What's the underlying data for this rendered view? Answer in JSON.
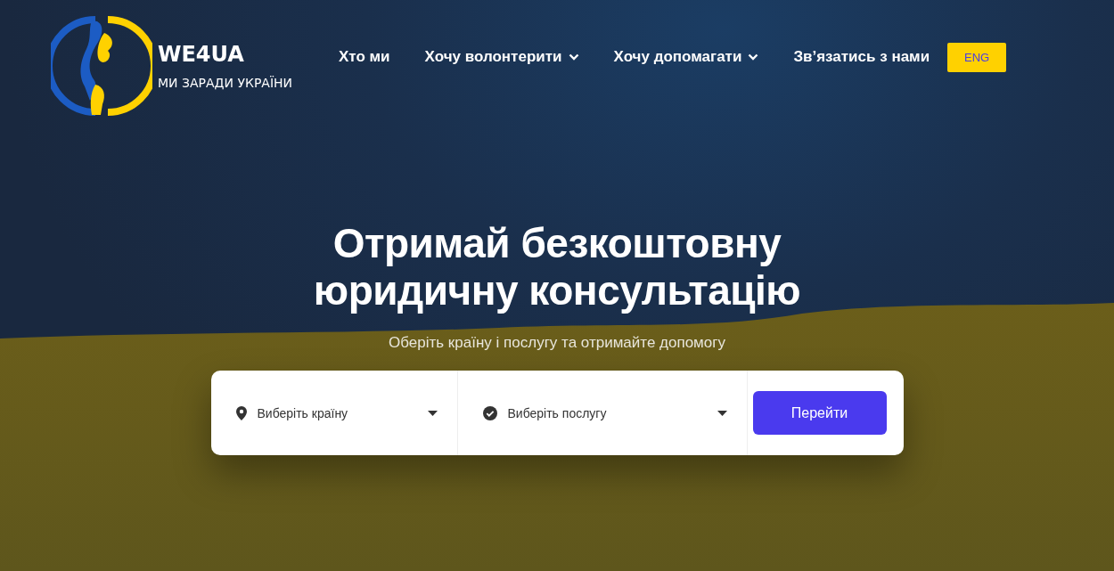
{
  "logo": {
    "name": "WE4UA",
    "tagline": "МИ ЗАРАДИ УКРАЇНИ"
  },
  "nav": [
    {
      "label": "Хто ми",
      "kind": "link"
    },
    {
      "label": "Хочу волонтерити",
      "kind": "dropdown"
    },
    {
      "label": "Хочу допомагати",
      "kind": "dropdown"
    },
    {
      "label": "Зв’язатись з нами",
      "kind": "link"
    }
  ],
  "language_button": "ENG",
  "hero": {
    "title_lines": [
      "Отримай безкоштовну",
      "юридичну консультацію"
    ],
    "subtitle": "Оберіть країну і послугу та отримайте допомогу"
  },
  "search": {
    "selects": [
      {
        "placeholder": "Виберіть країну",
        "kind": "location"
      },
      {
        "placeholder": "Виберіть послугу",
        "kind": "service"
      }
    ],
    "button": "Перейти"
  }
}
